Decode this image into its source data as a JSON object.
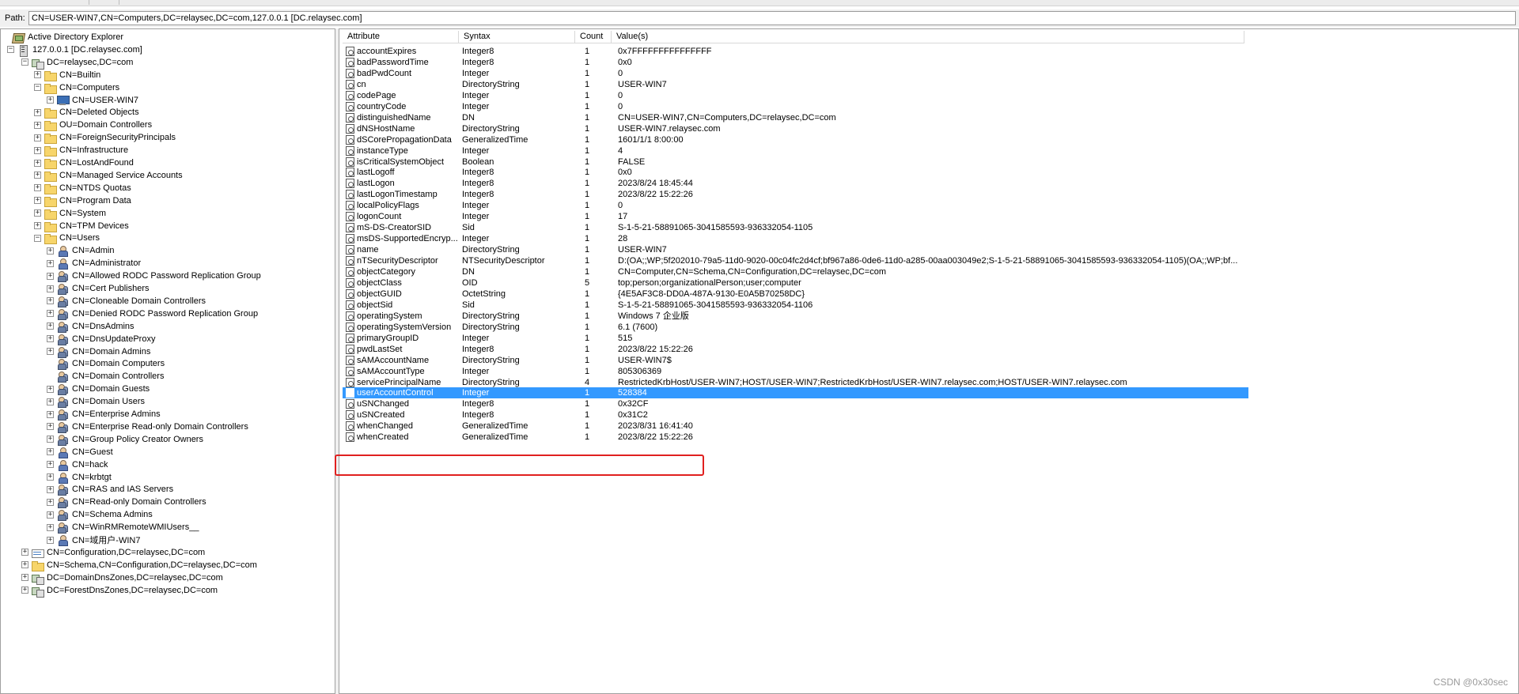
{
  "path": {
    "label": "Path:",
    "value": "CN=USER-WIN7,CN=Computers,DC=relaysec,DC=com,127.0.0.1 [DC.relaysec.com]"
  },
  "tree": [
    {
      "label": "Active Directory Explorer",
      "icon": "ad-explorer-icon",
      "expander": ""
    },
    {
      "label": "127.0.0.1 [DC.relaysec.com]",
      "icon": "server-icon",
      "expander": "-"
    },
    {
      "label": "DC=relaysec,DC=com",
      "icon": "domain-icon",
      "expander": "-"
    },
    {
      "label": "CN=Builtin",
      "icon": "folder-icon",
      "expander": "+"
    },
    {
      "label": "CN=Computers",
      "icon": "folder-icon",
      "expander": "-"
    },
    {
      "label": "CN=USER-WIN7",
      "icon": "computer-icon",
      "expander": "+"
    },
    {
      "label": "CN=Deleted Objects",
      "icon": "folder-icon",
      "expander": "+"
    },
    {
      "label": "OU=Domain Controllers",
      "icon": "folder-icon",
      "expander": "+"
    },
    {
      "label": "CN=ForeignSecurityPrincipals",
      "icon": "folder-icon",
      "expander": "+"
    },
    {
      "label": "CN=Infrastructure",
      "icon": "folder-icon",
      "expander": "+"
    },
    {
      "label": "CN=LostAndFound",
      "icon": "folder-icon",
      "expander": "+"
    },
    {
      "label": "CN=Managed Service Accounts",
      "icon": "folder-icon",
      "expander": "+"
    },
    {
      "label": "CN=NTDS Quotas",
      "icon": "folder-icon",
      "expander": "+"
    },
    {
      "label": "CN=Program Data",
      "icon": "folder-icon",
      "expander": "+"
    },
    {
      "label": "CN=System",
      "icon": "folder-icon",
      "expander": "+"
    },
    {
      "label": "CN=TPM Devices",
      "icon": "folder-icon",
      "expander": "+"
    },
    {
      "label": "CN=Users",
      "icon": "folder-icon",
      "expander": "-"
    },
    {
      "label": "CN=Admin",
      "icon": "user-icon",
      "expander": "+"
    },
    {
      "label": "CN=Administrator",
      "icon": "user-icon",
      "expander": "+"
    },
    {
      "label": "CN=Allowed RODC Password Replication Group",
      "icon": "group-icon",
      "expander": "+"
    },
    {
      "label": "CN=Cert Publishers",
      "icon": "group-icon",
      "expander": "+"
    },
    {
      "label": "CN=Cloneable Domain Controllers",
      "icon": "group-icon",
      "expander": "+"
    },
    {
      "label": "CN=Denied RODC Password Replication Group",
      "icon": "group-icon",
      "expander": "+"
    },
    {
      "label": "CN=DnsAdmins",
      "icon": "group-icon",
      "expander": "+"
    },
    {
      "label": "CN=DnsUpdateProxy",
      "icon": "group-icon",
      "expander": "+"
    },
    {
      "label": "CN=Domain Admins",
      "icon": "group-icon",
      "expander": "+"
    },
    {
      "label": "CN=Domain Computers",
      "icon": "group-icon",
      "expander": ""
    },
    {
      "label": "CN=Domain Controllers",
      "icon": "group-icon",
      "expander": ""
    },
    {
      "label": "CN=Domain Guests",
      "icon": "group-icon",
      "expander": "+"
    },
    {
      "label": "CN=Domain Users",
      "icon": "group-icon",
      "expander": "+"
    },
    {
      "label": "CN=Enterprise Admins",
      "icon": "group-icon",
      "expander": "+"
    },
    {
      "label": "CN=Enterprise Read-only Domain Controllers",
      "icon": "group-icon",
      "expander": "+"
    },
    {
      "label": "CN=Group Policy Creator Owners",
      "icon": "group-icon",
      "expander": "+"
    },
    {
      "label": "CN=Guest",
      "icon": "user-icon",
      "expander": "+"
    },
    {
      "label": "CN=hack",
      "icon": "user-icon",
      "expander": "+"
    },
    {
      "label": "CN=krbtgt",
      "icon": "user-icon",
      "expander": "+"
    },
    {
      "label": "CN=RAS and IAS Servers",
      "icon": "group-icon",
      "expander": "+"
    },
    {
      "label": "CN=Read-only Domain Controllers",
      "icon": "group-icon",
      "expander": "+"
    },
    {
      "label": "CN=Schema Admins",
      "icon": "group-icon",
      "expander": "+"
    },
    {
      "label": "CN=WinRMRemoteWMIUsers__",
      "icon": "group-icon",
      "expander": "+"
    },
    {
      "label": "CN=域用户-WIN7",
      "icon": "user-icon",
      "expander": "+"
    },
    {
      "label": "CN=Configuration,DC=relaysec,DC=com",
      "icon": "config-icon",
      "expander": "+"
    },
    {
      "label": "CN=Schema,CN=Configuration,DC=relaysec,DC=com",
      "icon": "folder-icon",
      "expander": "+"
    },
    {
      "label": "DC=DomainDnsZones,DC=relaysec,DC=com",
      "icon": "domain-icon",
      "expander": "+"
    },
    {
      "label": "DC=ForestDnsZones,DC=relaysec,DC=com",
      "icon": "domain-icon",
      "expander": "+"
    }
  ],
  "table": {
    "columns": [
      "Attribute",
      "Syntax",
      "Count",
      "Value(s)"
    ],
    "rows": [
      {
        "attribute": "accountExpires",
        "syntax": "Integer8",
        "count": "1",
        "value": "0x7FFFFFFFFFFFFFFF"
      },
      {
        "attribute": "badPasswordTime",
        "syntax": "Integer8",
        "count": "1",
        "value": "0x0"
      },
      {
        "attribute": "badPwdCount",
        "syntax": "Integer",
        "count": "1",
        "value": "0"
      },
      {
        "attribute": "cn",
        "syntax": "DirectoryString",
        "count": "1",
        "value": "USER-WIN7"
      },
      {
        "attribute": "codePage",
        "syntax": "Integer",
        "count": "1",
        "value": "0"
      },
      {
        "attribute": "countryCode",
        "syntax": "Integer",
        "count": "1",
        "value": "0"
      },
      {
        "attribute": "distinguishedName",
        "syntax": "DN",
        "count": "1",
        "value": "CN=USER-WIN7,CN=Computers,DC=relaysec,DC=com"
      },
      {
        "attribute": "dNSHostName",
        "syntax": "DirectoryString",
        "count": "1",
        "value": "USER-WIN7.relaysec.com"
      },
      {
        "attribute": "dSCorePropagationData",
        "syntax": "GeneralizedTime",
        "count": "1",
        "value": "1601/1/1 8:00:00"
      },
      {
        "attribute": "instanceType",
        "syntax": "Integer",
        "count": "1",
        "value": "4"
      },
      {
        "attribute": "isCriticalSystemObject",
        "syntax": "Boolean",
        "count": "1",
        "value": "FALSE"
      },
      {
        "attribute": "lastLogoff",
        "syntax": "Integer8",
        "count": "1",
        "value": "0x0"
      },
      {
        "attribute": "lastLogon",
        "syntax": "Integer8",
        "count": "1",
        "value": "2023/8/24 18:45:44"
      },
      {
        "attribute": "lastLogonTimestamp",
        "syntax": "Integer8",
        "count": "1",
        "value": "2023/8/22 15:22:26"
      },
      {
        "attribute": "localPolicyFlags",
        "syntax": "Integer",
        "count": "1",
        "value": "0"
      },
      {
        "attribute": "logonCount",
        "syntax": "Integer",
        "count": "1",
        "value": "17"
      },
      {
        "attribute": "mS-DS-CreatorSID",
        "syntax": "Sid",
        "count": "1",
        "value": "S-1-5-21-58891065-3041585593-936332054-1105"
      },
      {
        "attribute": "msDS-SupportedEncryp...",
        "syntax": "Integer",
        "count": "1",
        "value": "28"
      },
      {
        "attribute": "name",
        "syntax": "DirectoryString",
        "count": "1",
        "value": "USER-WIN7"
      },
      {
        "attribute": "nTSecurityDescriptor",
        "syntax": "NTSecurityDescriptor",
        "count": "1",
        "value": "D:(OA;;WP;5f202010-79a5-11d0-9020-00c04fc2d4cf;bf967a86-0de6-11d0-a285-00aa003049e2;S-1-5-21-58891065-3041585593-936332054-1105)(OA;;WP;bf..."
      },
      {
        "attribute": "objectCategory",
        "syntax": "DN",
        "count": "1",
        "value": "CN=Computer,CN=Schema,CN=Configuration,DC=relaysec,DC=com"
      },
      {
        "attribute": "objectClass",
        "syntax": "OID",
        "count": "5",
        "value": "top;person;organizationalPerson;user;computer"
      },
      {
        "attribute": "objectGUID",
        "syntax": "OctetString",
        "count": "1",
        "value": "{4E5AF3C8-DD0A-487A-9130-E0A5B70258DC}"
      },
      {
        "attribute": "objectSid",
        "syntax": "Sid",
        "count": "1",
        "value": "S-1-5-21-58891065-3041585593-936332054-1106"
      },
      {
        "attribute": "operatingSystem",
        "syntax": "DirectoryString",
        "count": "1",
        "value": "Windows 7 企业版"
      },
      {
        "attribute": "operatingSystemVersion",
        "syntax": "DirectoryString",
        "count": "1",
        "value": "6.1 (7600)"
      },
      {
        "attribute": "primaryGroupID",
        "syntax": "Integer",
        "count": "1",
        "value": "515"
      },
      {
        "attribute": "pwdLastSet",
        "syntax": "Integer8",
        "count": "1",
        "value": "2023/8/22 15:22:26"
      },
      {
        "attribute": "sAMAccountName",
        "syntax": "DirectoryString",
        "count": "1",
        "value": "USER-WIN7$"
      },
      {
        "attribute": "sAMAccountType",
        "syntax": "Integer",
        "count": "1",
        "value": "805306369"
      },
      {
        "attribute": "servicePrincipalName",
        "syntax": "DirectoryString",
        "count": "4",
        "value": "RestrictedKrbHost/USER-WIN7;HOST/USER-WIN7;RestrictedKrbHost/USER-WIN7.relaysec.com;HOST/USER-WIN7.relaysec.com"
      },
      {
        "attribute": "userAccountControl",
        "syntax": "Integer",
        "count": "1",
        "value": "528384",
        "selected": true
      },
      {
        "attribute": "uSNChanged",
        "syntax": "Integer8",
        "count": "1",
        "value": "0x32CF"
      },
      {
        "attribute": "uSNCreated",
        "syntax": "Integer8",
        "count": "1",
        "value": "0x31C2"
      },
      {
        "attribute": "whenChanged",
        "syntax": "GeneralizedTime",
        "count": "1",
        "value": "2023/8/31 16:41:40"
      },
      {
        "attribute": "whenCreated",
        "syntax": "GeneralizedTime",
        "count": "1",
        "value": "2023/8/22 15:22:26"
      }
    ]
  },
  "colors": {
    "selection": "#3399ff",
    "annotation_box": "#e0201f"
  },
  "watermark": "CSDN @0x30sec"
}
